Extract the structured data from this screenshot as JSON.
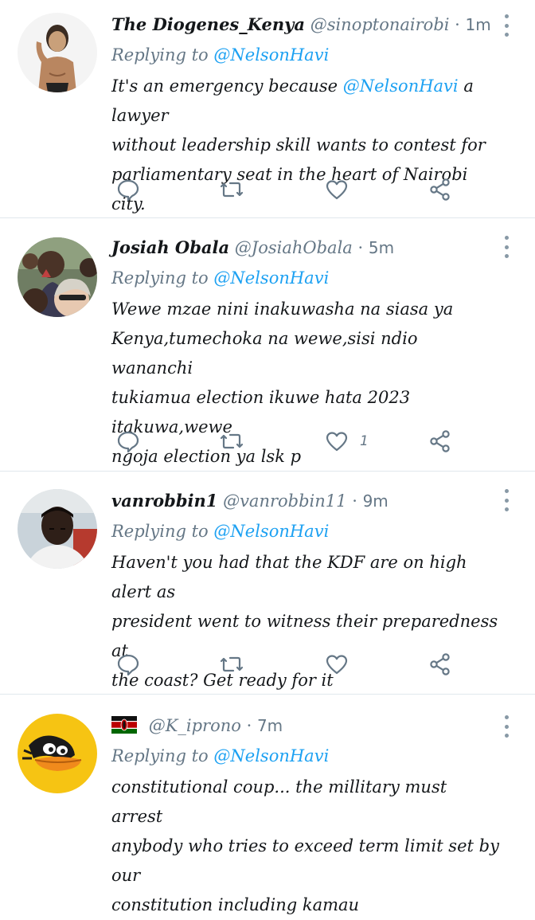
{
  "tweets": [
    {
      "name": "The Diogenes_Kenya",
      "handle": "@sinoptonairobi",
      "separator": "·",
      "time": "1m",
      "reply_prefix": "Replying to",
      "reply_to": "@NelsonHavi",
      "text_lines": [
        {
          "before": "It's an emergency because ",
          "mention": "@NelsonHavi",
          "after": " a lawyer"
        },
        {
          "before": "without leadership skill wants to contest for",
          "mention": "",
          "after": ""
        },
        {
          "before": "parliamentary seat in the heart of Nairobi city.",
          "mention": "",
          "after": ""
        }
      ],
      "likes": ""
    },
    {
      "name": "Josiah Obala",
      "handle": "@JosiahObala",
      "separator": "·",
      "time": "5m",
      "reply_prefix": "Replying to",
      "reply_to": "@NelsonHavi",
      "text_lines": [
        {
          "before": "Wewe mzae nini inakuwasha na siasa ya",
          "mention": "",
          "after": ""
        },
        {
          "before": "Kenya,tumechoka na wewe,sisi ndio wananchi",
          "mention": "",
          "after": ""
        },
        {
          "before": "tukiamua election ikuwe hata 2023 itakuwa,wewe",
          "mention": "",
          "after": ""
        },
        {
          "before": "ngoja election ya lsk p",
          "mention": "",
          "after": ""
        }
      ],
      "likes": "1"
    },
    {
      "name": "vanrobbin1",
      "handle": "@vanrobbin11",
      "separator": "·",
      "time": "9m",
      "reply_prefix": "Replying to",
      "reply_to": "@NelsonHavi",
      "text_lines": [
        {
          "before": "Haven't you had that the KDF are on high alert as",
          "mention": "",
          "after": ""
        },
        {
          "before": "president went to witness their preparedness at",
          "mention": "",
          "after": ""
        },
        {
          "before": "the coast? Get ready for it",
          "mention": "",
          "after": ""
        }
      ],
      "likes": ""
    },
    {
      "name": "",
      "handle": "@K_iprono",
      "separator": "·",
      "time": "7m",
      "reply_prefix": "Replying to",
      "reply_to": "@NelsonHavi",
      "text_lines": [
        {
          "before": "constitutional coup... the millitary must arrest",
          "mention": "",
          "after": ""
        },
        {
          "before": "anybody who tries to exceed term limit set by our",
          "mention": "",
          "after": ""
        },
        {
          "before": "constitution including kamau",
          "mention": "",
          "after": ""
        }
      ],
      "likes": ""
    }
  ],
  "icons": {
    "reply": "speech-bubble-icon",
    "retweet": "retweet-icon",
    "like": "heart-icon",
    "share": "share-icon",
    "more": "more-vertical-icon",
    "flag": "kenya-flag-icon"
  },
  "colors": {
    "mention": "#1da1f2",
    "muted": "#657786",
    "text": "#14171a",
    "divider": "#e1e8ed"
  }
}
